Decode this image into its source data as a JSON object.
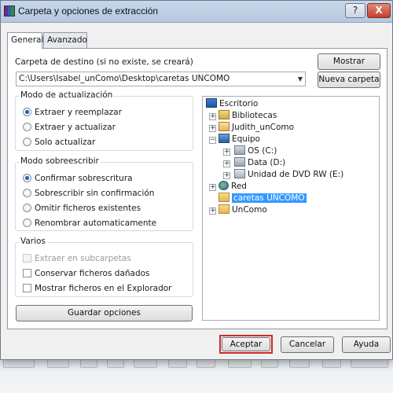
{
  "window": {
    "title": "Carpeta y opciones de extracción",
    "help_btn": "?",
    "close_btn": "X"
  },
  "tabs": [
    {
      "label": "General",
      "active": true
    },
    {
      "label": "Avanzado",
      "active": false
    }
  ],
  "destination": {
    "label": "Carpeta de destino (si no existe, se creará)",
    "value": "C:\\Users\\Isabel_unComo\\Desktop\\caretas UNCOMO",
    "browse_btn": "Mostrar",
    "new_folder_btn": "Nueva carpeta"
  },
  "update_mode": {
    "title": "Modo de actualización",
    "options": [
      {
        "label": "Extraer y reemplazar",
        "selected": true
      },
      {
        "label": "Extraer y actualizar",
        "selected": false
      },
      {
        "label": "Solo actualizar",
        "selected": false
      }
    ]
  },
  "overwrite_mode": {
    "title": "Modo sobreescribir",
    "options": [
      {
        "label": "Confirmar sobrescritura",
        "selected": true
      },
      {
        "label": "Sobrescribir sin confirmación",
        "selected": false
      },
      {
        "label": "Omitir ficheros existentes",
        "selected": false
      },
      {
        "label": "Renombrar automaticamente",
        "selected": false
      }
    ]
  },
  "misc": {
    "title": "Varios",
    "options": [
      {
        "label": "Extraer en subcarpetas",
        "checked": false,
        "disabled": true
      },
      {
        "label": "Conservar ficheros dañados",
        "checked": false,
        "disabled": false
      },
      {
        "label": "Mostrar ficheros en el Explorador",
        "checked": false,
        "disabled": false
      }
    ],
    "save_btn": "Guardar opciones"
  },
  "tree": {
    "root": "Escritorio",
    "bibliotecas": "Bibliotecas",
    "user": "Judith_unComo",
    "equipo": "Equipo",
    "os": "OS (C:)",
    "data": "Data (D:)",
    "dvd": "Unidad de DVD RW (E:)",
    "red": "Red",
    "caretas": "caretas UNCOMO",
    "uncomo": "UnComo"
  },
  "footer": {
    "accept": "Aceptar",
    "cancel": "Cancelar",
    "help": "Ayuda"
  },
  "colors": {
    "highlight": "#d22a2a",
    "selection": "#3399ff"
  }
}
